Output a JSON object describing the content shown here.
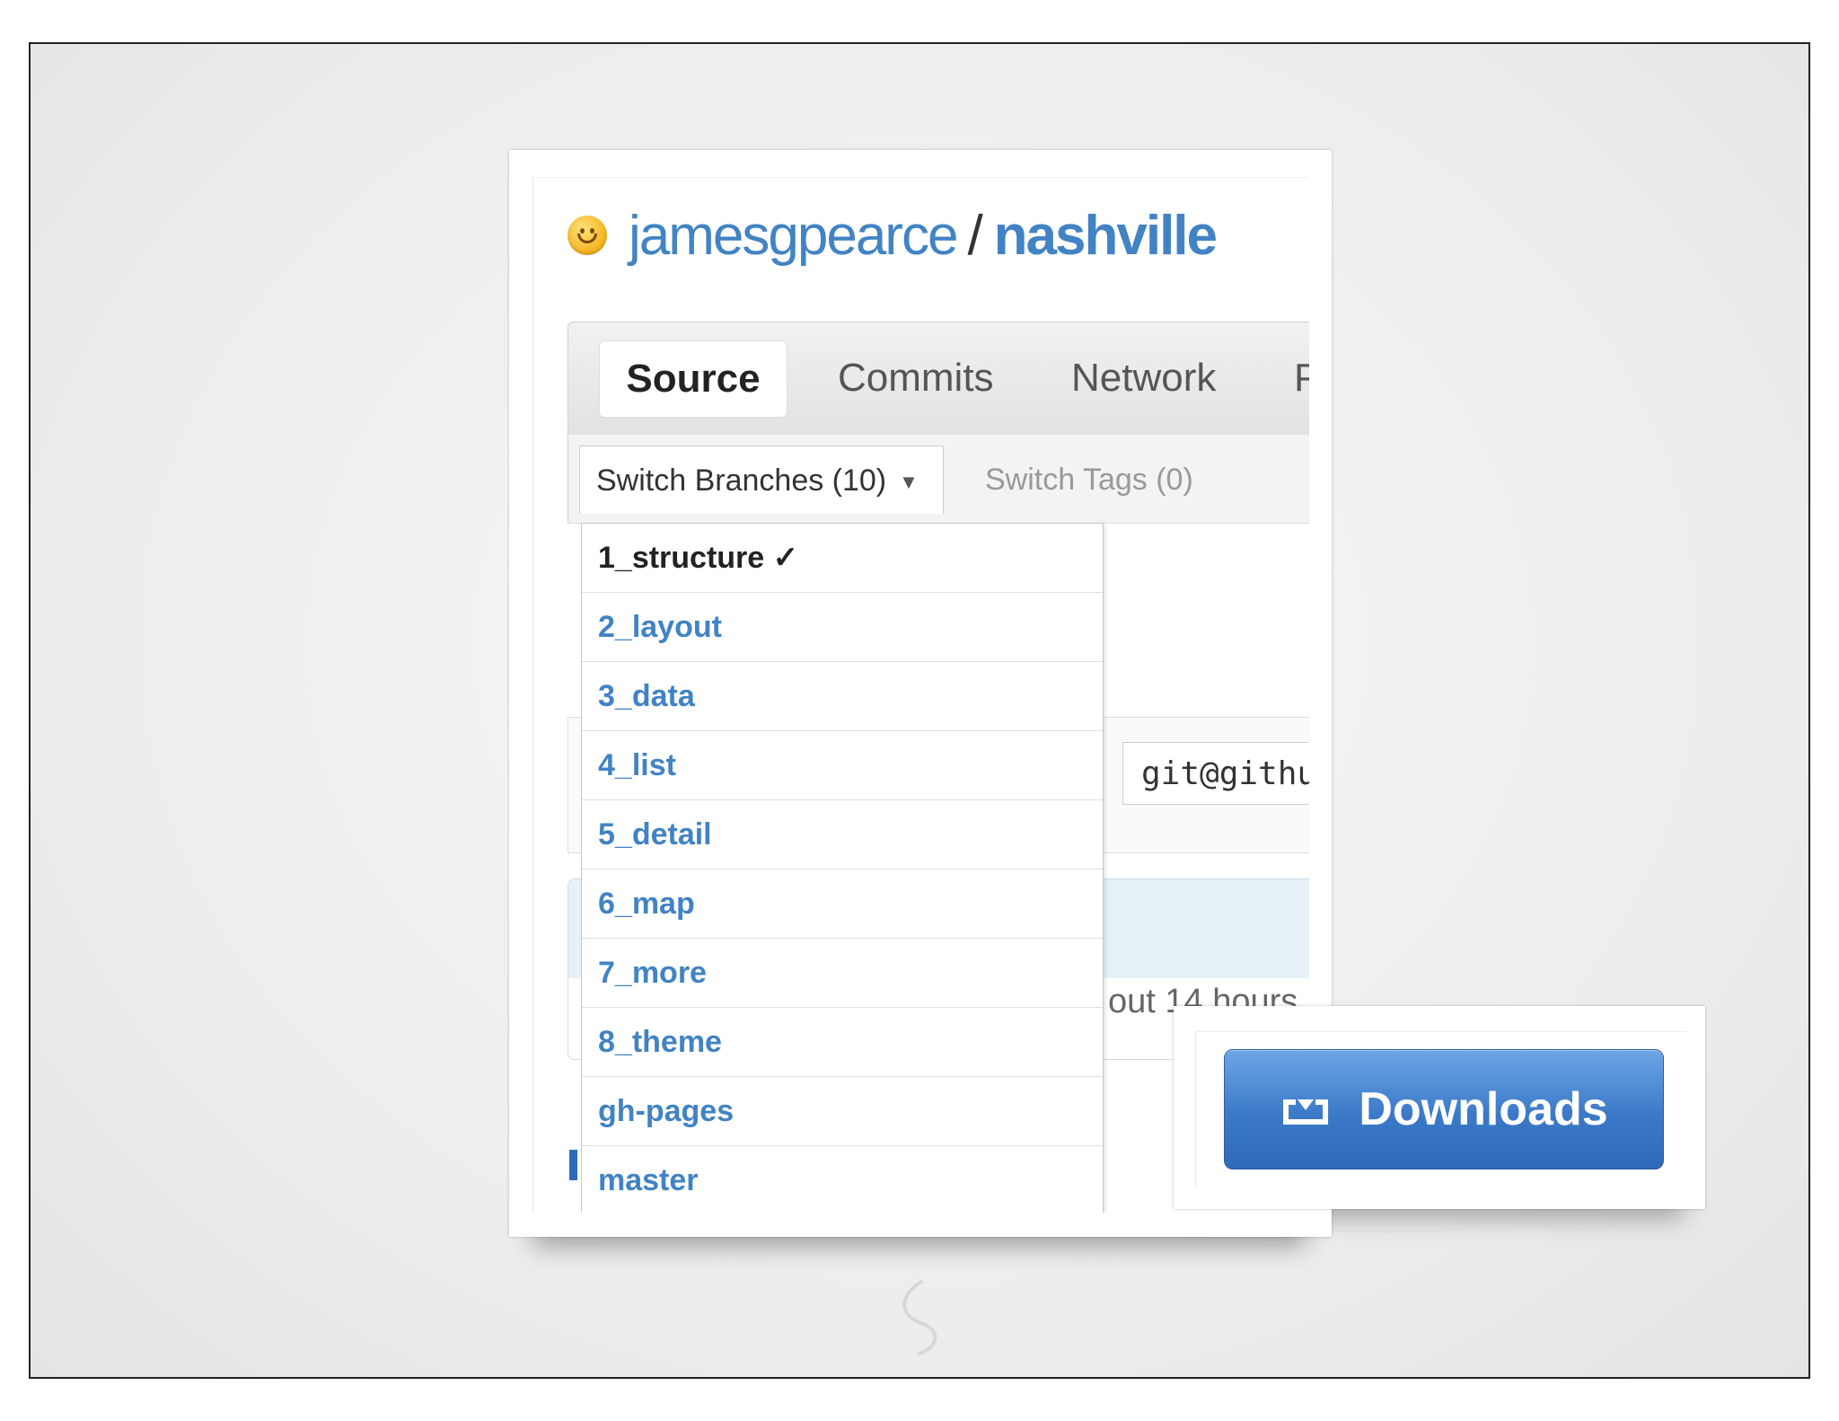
{
  "repo": {
    "owner": "jamesgpearce",
    "separator": "/",
    "name": "nashville"
  },
  "tabs": [
    {
      "label": "Source",
      "active": true
    },
    {
      "label": "Commits",
      "active": false
    },
    {
      "label": "Network",
      "active": false
    },
    {
      "label": "P",
      "active": false
    }
  ],
  "branch_switcher": {
    "label": "Switch Branches (10)",
    "caret": "▼",
    "tags_label": "Switch Tags (0)"
  },
  "branches": [
    {
      "name": "1_structure ✓",
      "current": true
    },
    {
      "name": "2_layout",
      "current": false
    },
    {
      "name": "3_data",
      "current": false
    },
    {
      "name": "4_list",
      "current": false
    },
    {
      "name": "5_detail",
      "current": false
    },
    {
      "name": "6_map",
      "current": false
    },
    {
      "name": "7_more",
      "current": false
    },
    {
      "name": "8_theme",
      "current": false
    },
    {
      "name": "gh-pages",
      "current": false
    },
    {
      "name": "master",
      "current": false
    }
  ],
  "clone_url": "git@github",
  "commit_age_fragment": "out 14 hours",
  "downloads_button": {
    "label": "Downloads",
    "icon": "download-tray-icon"
  },
  "colors": {
    "link": "#4183c4",
    "button_blue": "#3b79c8",
    "background": "#ececec"
  }
}
